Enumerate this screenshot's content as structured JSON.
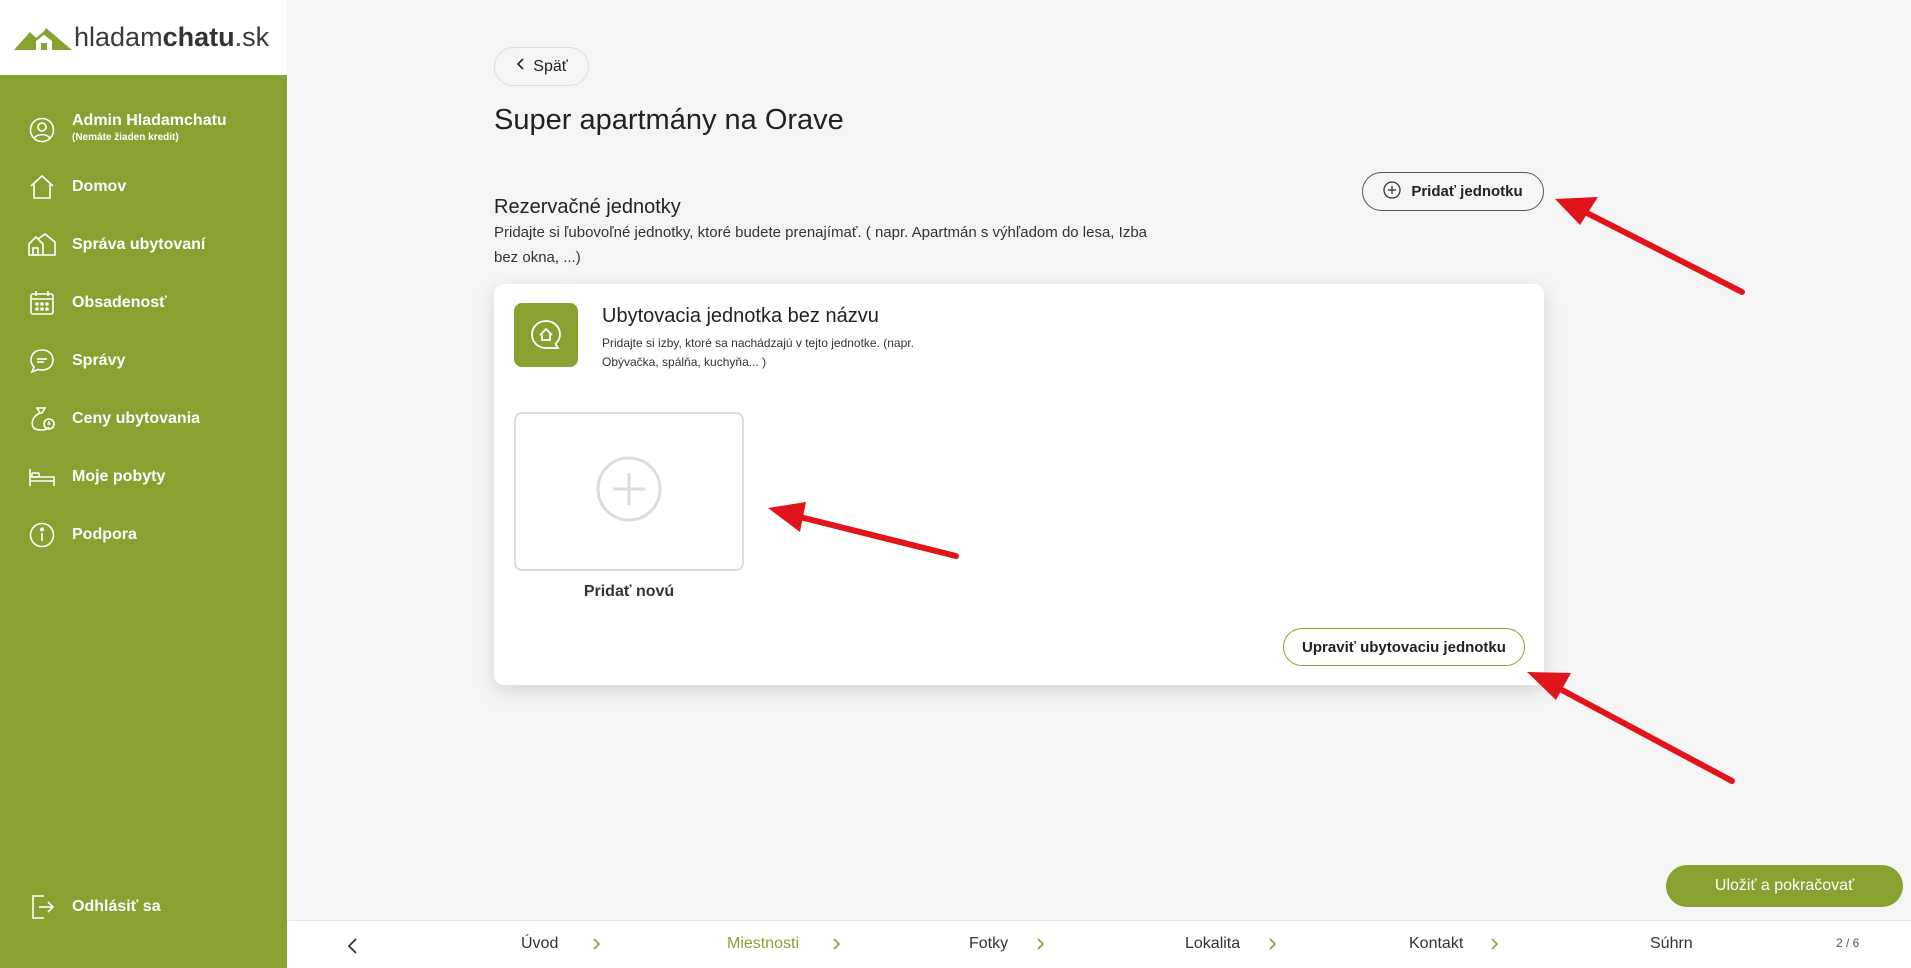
{
  "logo": {
    "light": "hladam",
    "bold": "chatu",
    "suffix": ".sk"
  },
  "sidebar": {
    "user": {
      "name": "Admin Hladamchatu",
      "credit": "(Nemáte žiaden kredit)"
    },
    "items": [
      {
        "label": "Domov",
        "icon": "home-icon"
      },
      {
        "label": "Správa ubytovaní",
        "icon": "houses-icon"
      },
      {
        "label": "Obsadenosť",
        "icon": "calendar-icon"
      },
      {
        "label": "Správy",
        "icon": "message-icon"
      },
      {
        "label": "Ceny ubytovania",
        "icon": "money-bag-icon"
      },
      {
        "label": "Moje pobyty",
        "icon": "bed-icon"
      },
      {
        "label": "Podpora",
        "icon": "info-icon"
      }
    ],
    "logout": "Odhlásiť sa"
  },
  "main": {
    "back_label": "Späť",
    "title": "Super apartmány na Orave",
    "section_title": "Rezervačné jednotky",
    "section_desc": "Pridajte si ľubovoľné jednotky, ktoré budete prenajímať. ( napr. Apartmán s výhľadom do lesa, Izba bez okna, ...)",
    "add_unit_label": "Pridať jednotku",
    "card": {
      "title": "Ubytovacia jednotka bez názvu",
      "desc": "Pridajte si izby, ktoré sa nachádzajú v tejto jednotke. (napr. Obývačka, spálňa, kuchyňa... )",
      "add_new_label": "Pridať novú",
      "edit_label": "Upraviť ubytovaciu jednotku"
    },
    "save_label": "Uložiť a pokračovať"
  },
  "steps": {
    "items": [
      "Úvod",
      "Miestnosti",
      "Fotky",
      "Lokalita",
      "Kontakt",
      "Súhrn"
    ],
    "active": "Miestnosti",
    "page_count": "2 / 6"
  },
  "colors": {
    "accent": "#88a232",
    "arrow": "#e0141a",
    "background": "#f5f5f5"
  }
}
